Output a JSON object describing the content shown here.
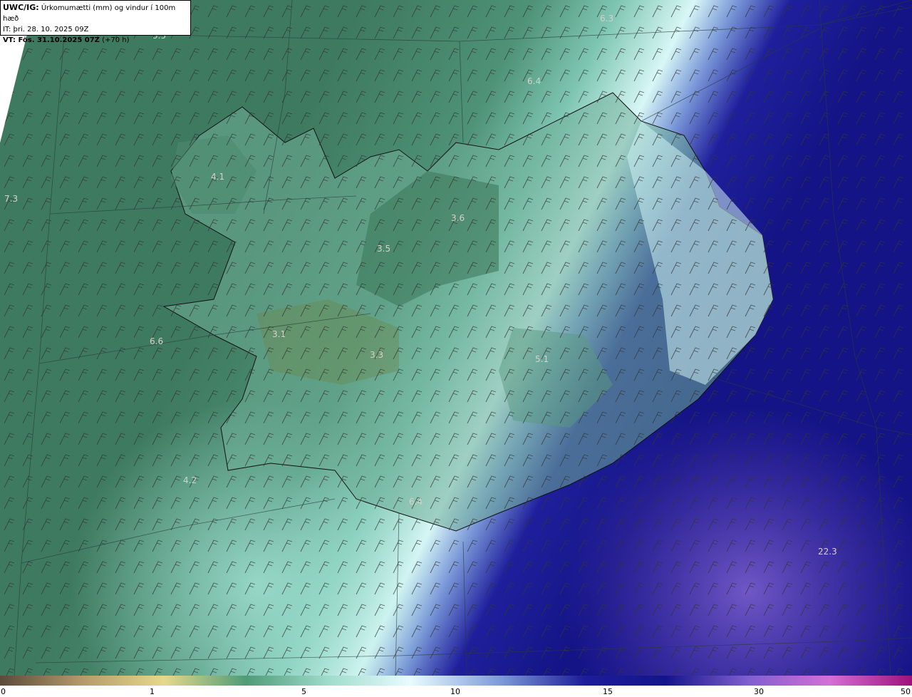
{
  "header": {
    "title_bold": "UWC/IG:",
    "title_rest": " Úrkomumætti (mm) og vindur í 100m hæð",
    "issue_time": "IT: þri. 28. 10. 2025 09Z",
    "valid_bold": "VT: Fös. 31.10.2025 07Z",
    "valid_rest": " (+70 h)"
  },
  "value_labels": [
    "6.3",
    "5.5",
    "6.4",
    "7.3",
    "4.1",
    "3.6",
    "3.5",
    "3.1",
    "3.3",
    "6.6",
    "5.1",
    "4.2",
    "6.4",
    "22.3"
  ],
  "colorbar": {
    "ticks": [
      "0",
      "1",
      "5",
      "10",
      "15",
      "30",
      "50"
    ],
    "colors": [
      "#5a4a3a",
      "#b59a6a",
      "#e6d98a",
      "#4f9b78",
      "#9fdccb",
      "#e8fbff",
      "#7c99d8",
      "#1d1d9a",
      "#14148a",
      "#7f5fcf",
      "#d36fd6",
      "#a0107a"
    ]
  },
  "map_colors": {
    "low": "#3f7a5f",
    "mid": "#7fc6b2",
    "light": "#d9f7f6",
    "blue": "#2a2aa5",
    "deep": "#12127e",
    "violet": "#6f55c9"
  }
}
